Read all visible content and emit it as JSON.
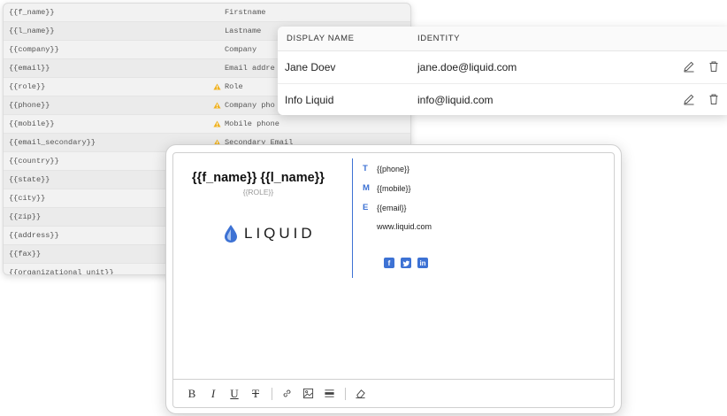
{
  "placeholders": [
    {
      "key": "{{f_name}}",
      "label": "Firstname",
      "warning": false
    },
    {
      "key": "{{l_name}}",
      "label": "Lastname",
      "warning": false
    },
    {
      "key": "{{company}}",
      "label": "Company",
      "warning": false
    },
    {
      "key": "{{email}}",
      "label": "Email addre",
      "warning": false
    },
    {
      "key": "{{role}}",
      "label": "Role",
      "warning": true
    },
    {
      "key": "{{phone}}",
      "label": "Company pho",
      "warning": true
    },
    {
      "key": "{{mobile}}",
      "label": "Mobile phone",
      "warning": true
    },
    {
      "key": "{{email_secondary}}",
      "label": "Secondary Email",
      "warning": true
    },
    {
      "key": "{{country}}",
      "label": "",
      "warning": false
    },
    {
      "key": "{{state}}",
      "label": "",
      "warning": false
    },
    {
      "key": "{{city}}",
      "label": "",
      "warning": false
    },
    {
      "key": "{{zip}}",
      "label": "",
      "warning": false
    },
    {
      "key": "{{address}}",
      "label": "",
      "warning": false
    },
    {
      "key": "{{fax}}",
      "label": "",
      "warning": false
    },
    {
      "key": "{{organizational_unit}}",
      "label": "",
      "warning": false
    }
  ],
  "identities": {
    "headers": {
      "display_name": "DISPLAY NAME",
      "identity": "IDENTITY"
    },
    "rows": [
      {
        "display_name": "Jane Doev",
        "identity": "jane.doe@liquid.com"
      },
      {
        "display_name": "Info Liquid",
        "identity": "info@liquid.com"
      }
    ]
  },
  "signature": {
    "name": "{{f_name}} {{l_name}}",
    "role": "{{ROLE}}",
    "logo_text": "LIQUID",
    "contacts": [
      {
        "letter": "T",
        "value": "{{phone}}"
      },
      {
        "letter": "M",
        "value": "{{mobile}}"
      },
      {
        "letter": "E",
        "value": "{{email}}"
      },
      {
        "letter": "",
        "value": "www.liquid.com"
      }
    ],
    "socials": [
      {
        "icon": "facebook-icon",
        "glyph": "f"
      },
      {
        "icon": "twitter-icon",
        "glyph": "t"
      },
      {
        "icon": "linkedin-icon",
        "glyph": "in"
      }
    ]
  },
  "toolbar": {
    "bold": "B",
    "italic": "I",
    "underline": "U",
    "strike": "T"
  },
  "colors": {
    "accent": "#3d72d4",
    "warning": "#f0b323"
  }
}
